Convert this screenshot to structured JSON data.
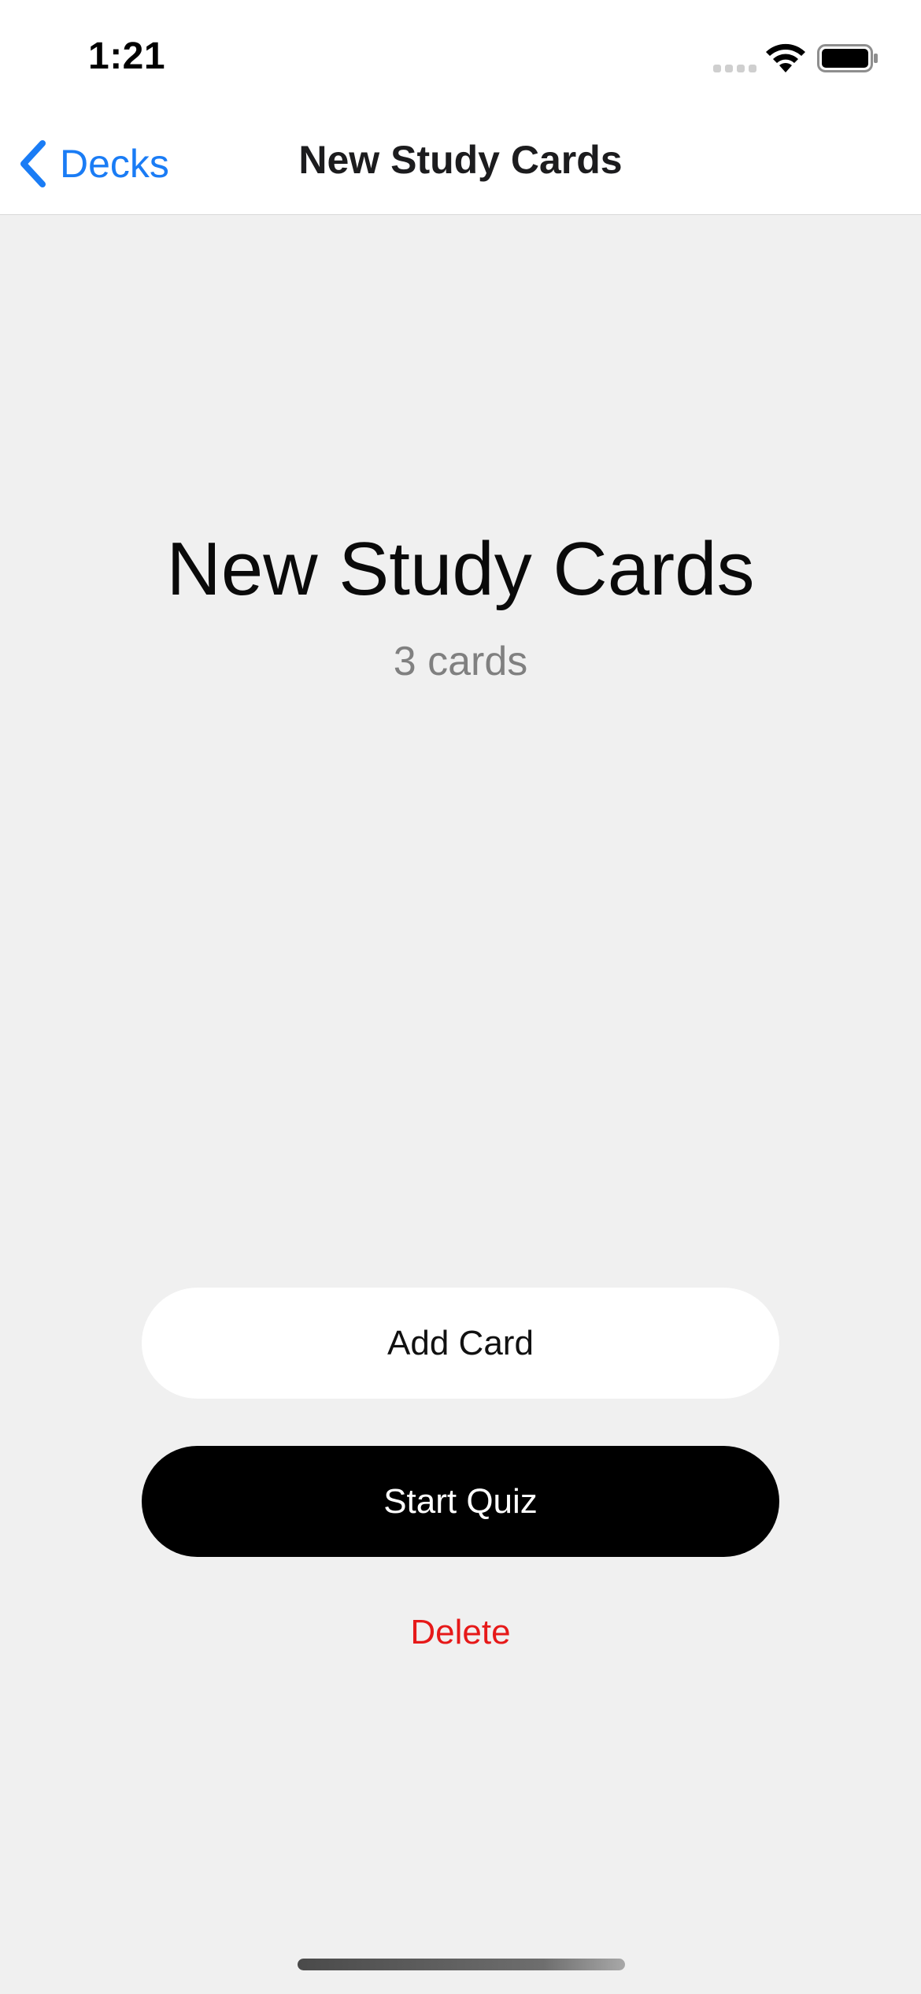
{
  "status_bar": {
    "time": "1:21",
    "icons": [
      "signal-icon",
      "wifi-icon",
      "battery-icon"
    ]
  },
  "nav": {
    "back_label": "Decks",
    "back_icon": "chevron-left-icon",
    "title": "New Study Cards"
  },
  "deck": {
    "title": "New Study Cards",
    "count": "3 cards"
  },
  "actions": {
    "add_card_label": "Add Card",
    "start_quiz_label": "Start Quiz",
    "delete_label": "Delete"
  },
  "colors": {
    "accent": "#1a7cf5",
    "destructive": "#e61919",
    "background": "#f0f0f0",
    "primary_button": "#000000",
    "secondary_button": "#ffffff"
  }
}
